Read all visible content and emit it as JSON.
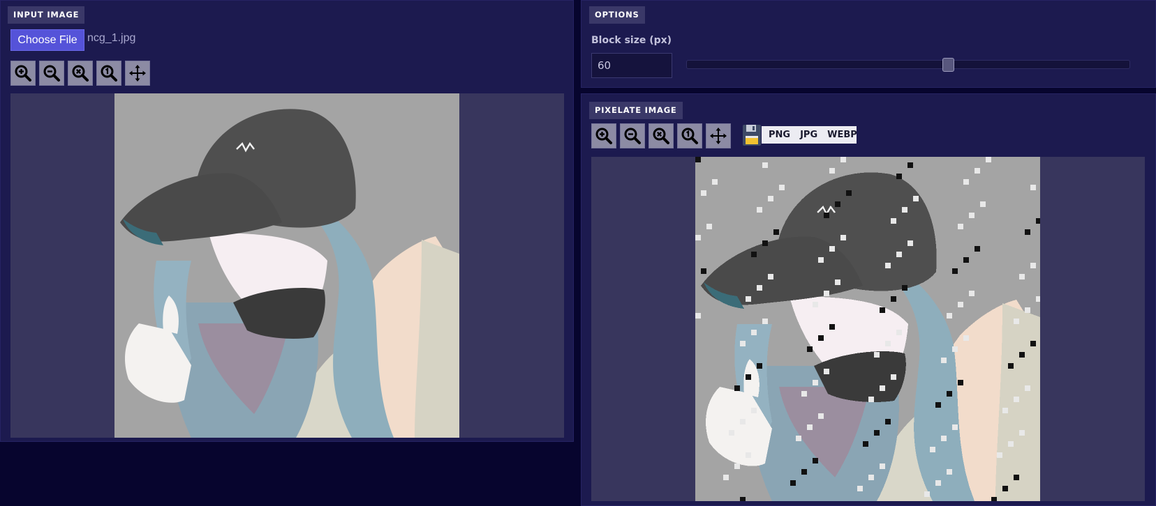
{
  "input_panel": {
    "title": "INPUT IMAGE",
    "choose_file_label": "Choose File",
    "file_name": "ncg_1.jpg",
    "toolbar": [
      "zoom-in-icon",
      "zoom-out-icon",
      "zoom-reset-icon",
      "zoom-actual-size-icon",
      "move-icon"
    ]
  },
  "options_panel": {
    "title": "OPTIONS",
    "block_size_label": "Block size (px)",
    "block_size_value": "60",
    "slider_fraction": 0.59
  },
  "pixelate_panel": {
    "title": "PIXELATE IMAGE",
    "toolbar": [
      "zoom-in-icon",
      "zoom-out-icon",
      "zoom-reset-icon",
      "zoom-actual-size-icon",
      "move-icon"
    ],
    "save_icon": "floppy-disk-icon",
    "formats": [
      "PNG",
      "JPG",
      "WEBP"
    ]
  },
  "colors": {
    "page_bg": "#07052e",
    "panel_bg": "#1c1a4f",
    "viewer_bg": "#38365d",
    "accent": "#5553d9",
    "artwork_bg": "#a4a4a4"
  }
}
